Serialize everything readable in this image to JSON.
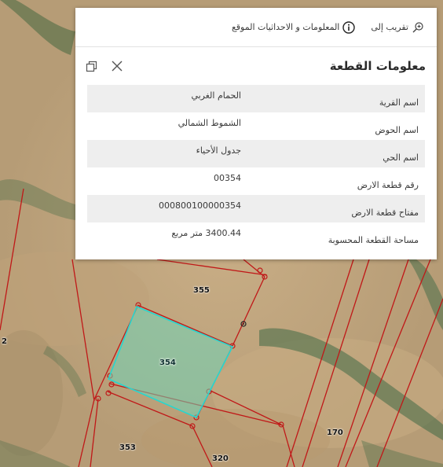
{
  "popup": {
    "actions": {
      "zoom_to": "تقريب إلى",
      "info_coords": "المعلومات و الاحداثيات الموقع"
    },
    "title": "معلومات القطعة",
    "attributes": [
      {
        "key": "اسم القرية",
        "value": "الحمام الغربي"
      },
      {
        "key": "اسم الحوض",
        "value": "الشموط الشمالي"
      },
      {
        "key": "اسم الحي",
        "value": "جدول الأحياء"
      },
      {
        "key": "رقم قطعة الارض",
        "value": "00354"
      },
      {
        "key": "مفتاح قطعة الارض",
        "value": "000800100000354"
      },
      {
        "key": "مساحة القطعة المحسوبة",
        "value": "3400.44 متر مربع"
      }
    ]
  },
  "map": {
    "parcel_labels": {
      "p355": "355",
      "p354": "354",
      "p353": "353",
      "p320": "320",
      "p170": "170",
      "p2": "2"
    },
    "colors": {
      "boundary": "#c01818",
      "selected_outline": "#27d6cf",
      "selected_fill": "#6fd6b8"
    }
  }
}
